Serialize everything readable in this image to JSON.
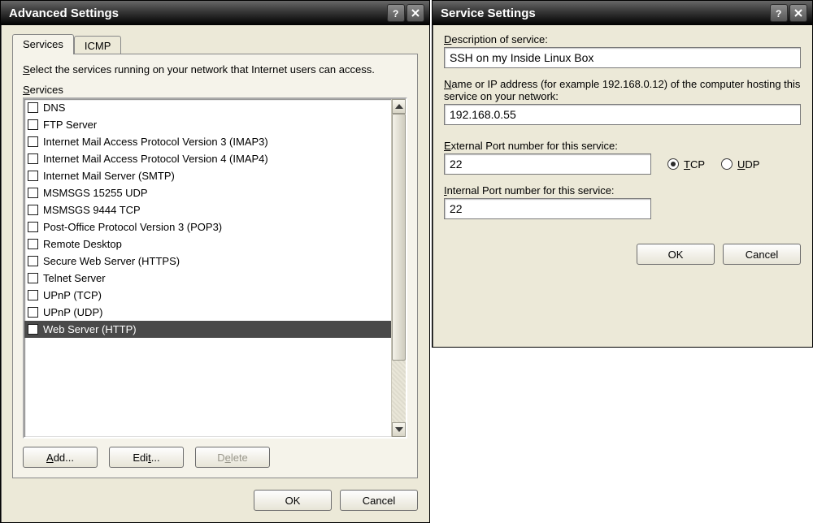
{
  "left": {
    "title": "Advanced Settings",
    "tabs": {
      "services": "Services",
      "icmp": "ICMP"
    },
    "instruction": "Select the services running on your network that Internet users can access.",
    "services_label": "Services",
    "services": [
      "DNS",
      "FTP Server",
      "Internet Mail Access Protocol Version 3 (IMAP3)",
      "Internet Mail Access Protocol Version 4 (IMAP4)",
      "Internet Mail Server (SMTP)",
      "MSMSGS 15255 UDP",
      "MSMSGS 9444 TCP",
      "Post-Office Protocol Version 3 (POP3)",
      "Remote Desktop",
      "Secure Web Server (HTTPS)",
      "Telnet Server",
      "UPnP (TCP)",
      "UPnP (UDP)",
      "Web Server (HTTP)"
    ],
    "selected_index": 13,
    "buttons": {
      "add": "Add...",
      "edit": "Edit...",
      "delete": "Delete"
    },
    "ok": "OK",
    "cancel": "Cancel"
  },
  "right": {
    "title": "Service Settings",
    "desc_label": "Description of service:",
    "desc_value": "SSH on my Inside Linux Box",
    "addr_label": "Name or IP address (for example 192.168.0.12) of the computer hosting this service on your network:",
    "addr_value": "192.168.0.55",
    "ext_port_label": "External Port number for this service:",
    "ext_port_value": "22",
    "int_port_label": "Internal Port number for this service:",
    "int_port_value": "22",
    "tcp": "TCP",
    "udp": "UDP",
    "protocol_selected": "tcp",
    "ok": "OK",
    "cancel": "Cancel"
  }
}
